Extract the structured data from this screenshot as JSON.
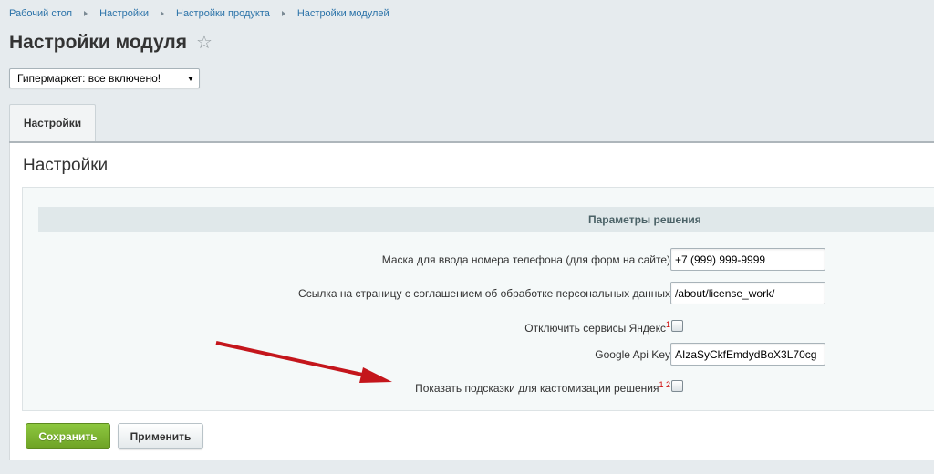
{
  "breadcrumb": {
    "items": [
      "Рабочий стол",
      "Настройки",
      "Настройки продукта",
      "Настройки модулей"
    ]
  },
  "page": {
    "title": "Настройки модуля",
    "star_icon": "star-icon"
  },
  "site_select": {
    "value": "Гипермаркет: все включено!"
  },
  "tabs": [
    {
      "label": "Настройки",
      "active": true
    }
  ],
  "section": {
    "title": "Настройки",
    "header": "Параметры решения"
  },
  "fields": [
    {
      "label": "Маска для ввода номера телефона (для форм на сайте)",
      "type": "text",
      "value": "+7 (999) 999-9999"
    },
    {
      "label": "Ссылка на страницу с соглашением об обработке персональных данных",
      "type": "text",
      "value": "/about/license_work/"
    },
    {
      "label": "Отключить сервисы Яндекс",
      "sup": "1",
      "type": "checkbox",
      "checked": false
    },
    {
      "label": "Google Api Key",
      "type": "text",
      "value": "AIzaSyCkfEmdydBoX3L70cg"
    },
    {
      "label": "Показать подсказки для кастомизации решения",
      "sup": "1 2",
      "type": "checkbox",
      "checked": false
    }
  ],
  "buttons": {
    "save": "Сохранить",
    "apply": "Применить"
  },
  "colors": {
    "link": "#2a72a8",
    "save_button": "#7ab232",
    "annotation_arrow": "#c4161c",
    "footnote": "#cc0000"
  }
}
